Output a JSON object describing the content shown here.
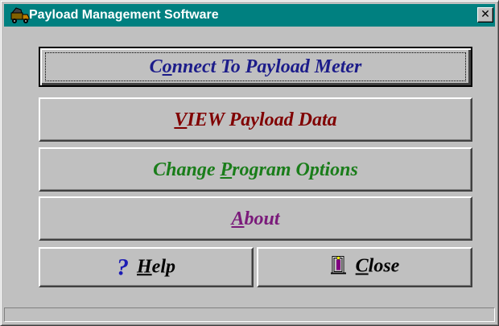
{
  "window": {
    "title": "Payload Management Software",
    "close_glyph": "✕",
    "icon": "truck-app-icon"
  },
  "buttons": {
    "connect": {
      "pre": "C",
      "mnemonic": "o",
      "post": "nnect To Payload Meter",
      "color": "#1c1c8a",
      "focused": true
    },
    "view": {
      "pre": "",
      "mnemonic": "V",
      "post": "IEW Payload Data",
      "color": "#800000"
    },
    "options": {
      "pre": "Change ",
      "mnemonic": "P",
      "post": "rogram Options",
      "color": "#1a7d1a"
    },
    "about": {
      "pre": "",
      "mnemonic": "A",
      "post": "bout",
      "color": "#7a1a7a"
    },
    "help": {
      "icon_text": "?",
      "mnemonic": "H",
      "post": "elp",
      "icon": "question-mark-icon"
    },
    "close": {
      "mnemonic": "C",
      "post": "lose",
      "icon": "exit-door-icon"
    }
  },
  "colors": {
    "titlebar": "#008080",
    "face": "#c0c0c0"
  }
}
